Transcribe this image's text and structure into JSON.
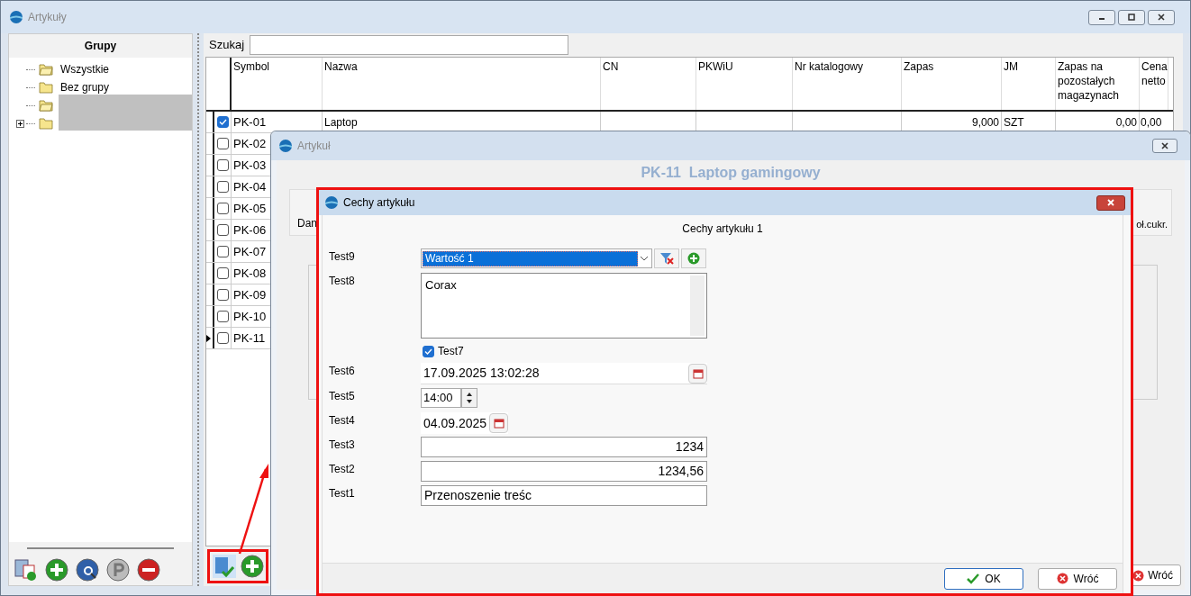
{
  "main_window": {
    "title": "Artykuły"
  },
  "groups": {
    "title": "Grupy",
    "tree": [
      {
        "label": "Wszystkie",
        "selected": false,
        "expandable": false
      },
      {
        "label": "Bez grupy",
        "selected": false,
        "expandable": false
      },
      {
        "selected": true,
        "expandable": false
      },
      {
        "selected": false,
        "expandable": true
      }
    ]
  },
  "search": {
    "label": "Szukaj"
  },
  "table": {
    "columns": [
      "Symbol",
      "Nazwa",
      "CN",
      "PKWiU",
      "Nr katalogowy",
      "Zapas",
      "JM",
      "Zapas na pozostałych magazynach",
      "Cena netto"
    ],
    "rows": [
      {
        "symbol": "PK-01",
        "name": "Laptop",
        "stock": "9,000",
        "unit": "SZT",
        "other_stock": "0,00",
        "net_price": "0,00",
        "checked": true,
        "current": false
      },
      {
        "symbol": "PK-02",
        "checked": false,
        "current": false
      },
      {
        "symbol": "PK-03",
        "checked": false,
        "current": false
      },
      {
        "symbol": "PK-04",
        "checked": false,
        "current": false
      },
      {
        "symbol": "PK-05",
        "checked": false,
        "current": false
      },
      {
        "symbol": "PK-06",
        "checked": false,
        "current": false
      },
      {
        "symbol": "PK-07",
        "checked": false,
        "current": false
      },
      {
        "symbol": "PK-08",
        "checked": false,
        "current": false
      },
      {
        "symbol": "PK-09",
        "checked": false,
        "current": false
      },
      {
        "symbol": "PK-10",
        "checked": false,
        "current": false
      },
      {
        "symbol": "PK-11",
        "checked": false,
        "current": true
      }
    ]
  },
  "article_window": {
    "title": "Artykuł",
    "heading": "PK-11  Laptop gamingowy",
    "tabs": [
      "Dan",
      "oł.cukr."
    ],
    "back_button": "Wróć"
  },
  "features_dialog": {
    "title": "Cechy artykułu",
    "heading": "Cechy artykułu 1",
    "fields": [
      {
        "kind": "select",
        "label": "Test9",
        "value": "Wartość 1"
      },
      {
        "kind": "memo",
        "label": "Test8",
        "value": "Corax"
      },
      {
        "kind": "checkbox",
        "label": "Test7",
        "checked": true
      },
      {
        "kind": "datetime",
        "label": "Test6",
        "value": "17.09.2025 13:02:28"
      },
      {
        "kind": "time",
        "label": "Test5",
        "value": "14:00"
      },
      {
        "kind": "date",
        "label": "Test4",
        "value": "04.09.2025"
      },
      {
        "kind": "number",
        "label": "Test3",
        "value": "1234"
      },
      {
        "kind": "number",
        "label": "Test2",
        "value": "1234,56"
      },
      {
        "kind": "text",
        "label": "Test1",
        "value": "Przenoszenie treśc"
      }
    ],
    "buttons": [
      {
        "kind": "ok",
        "label": "OK"
      },
      {
        "kind": "cancel",
        "label": "Wróć"
      }
    ]
  }
}
